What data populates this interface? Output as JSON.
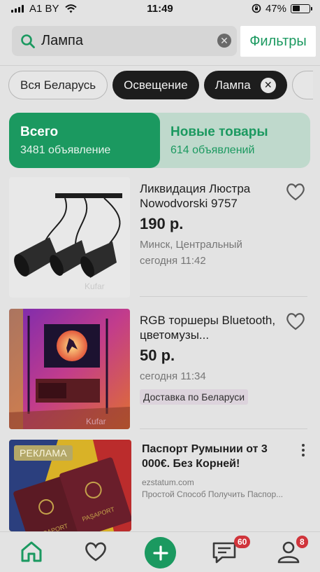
{
  "status_bar": {
    "carrier": "A1 BY",
    "time": "11:49",
    "battery": "47%",
    "battery_level": 0.47
  },
  "search": {
    "query": "Лампа",
    "filters_label": "Фильтры"
  },
  "chips": [
    {
      "label": "Вся Беларусь",
      "style": "outline"
    },
    {
      "label": "Освещение",
      "style": "dark"
    },
    {
      "label": "Лампа",
      "style": "dark",
      "removable": true
    }
  ],
  "toggle": {
    "all": {
      "title": "Всего",
      "subtitle": "3481 объявление"
    },
    "new": {
      "title": "Новые товары",
      "subtitle": "614 объявлений"
    }
  },
  "listings": [
    {
      "title": "Ликвидация Люстра Nowodvorski 9757",
      "price": "190 р.",
      "location": "Минск, Центральный",
      "time": "сегодня 11:42",
      "watermark": "Kufar"
    },
    {
      "title": "RGB торшеры Bluetooth, цветомузы...",
      "price": "50 р.",
      "time": "сегодня 11:34",
      "badge": "Доставка по Беларуси",
      "watermark": "Kufar"
    }
  ],
  "ad": {
    "label": "РЕКЛАМА",
    "title": "Паспорт Румынии от 3 000€. Без Корней!",
    "domain": "ezstatum.com",
    "text": "Простой Способ Получить Паспор..."
  },
  "bottom_nav": {
    "messages_count": "60",
    "profile_count": "8"
  },
  "colors": {
    "accent": "#1b9960",
    "dark_chip": "#1d1d1d",
    "badge_red": "#d0343b"
  },
  "icons": [
    "search-icon",
    "clear-icon",
    "close-icon",
    "heart-icon",
    "kebab-menu-icon",
    "home-icon",
    "plus-icon",
    "chat-icon",
    "profile-icon",
    "wifi-icon",
    "signal-icon",
    "battery-icon",
    "orientation-lock-icon"
  ]
}
